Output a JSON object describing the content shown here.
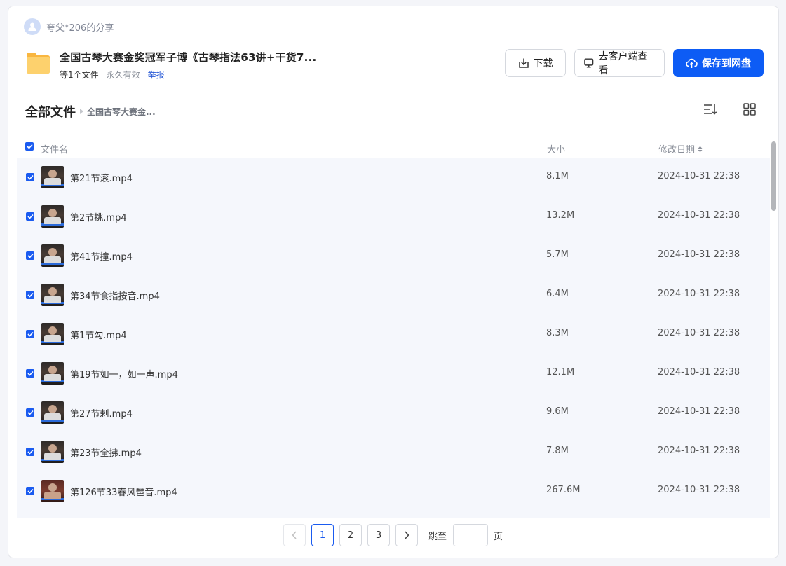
{
  "share": {
    "user_label": "夸父*206的分享",
    "file_title": "全国古琴大赛金奖冠军子博《古琴指法63讲+干货7...",
    "file_count": "等1个文件",
    "validity": "永久有效",
    "report_label": "举报"
  },
  "actions": {
    "download_label": "下载",
    "client_label": "去客户端查看",
    "save_label": "保存到网盘"
  },
  "breadcrumb": {
    "root": "全部文件",
    "current": "全国古琴大赛金..."
  },
  "table": {
    "col_name": "文件名",
    "col_size": "大小",
    "col_date": "修改日期",
    "rows": [
      {
        "name": "第21节滚.mp4",
        "size": "8.1M",
        "date": "2024-10-31 22:38"
      },
      {
        "name": "第2节挑.mp4",
        "size": "13.2M",
        "date": "2024-10-31 22:38"
      },
      {
        "name": "第41节撞.mp4",
        "size": "5.7M",
        "date": "2024-10-31 22:38"
      },
      {
        "name": "第34节食指按音.mp4",
        "size": "6.4M",
        "date": "2024-10-31 22:38"
      },
      {
        "name": "第1节勾.mp4",
        "size": "8.3M",
        "date": "2024-10-31 22:38"
      },
      {
        "name": "第19节如一，如一声.mp4",
        "size": "12.1M",
        "date": "2024-10-31 22:38"
      },
      {
        "name": "第27节剌.mp4",
        "size": "9.6M",
        "date": "2024-10-31 22:38"
      },
      {
        "name": "第23节全拂.mp4",
        "size": "7.8M",
        "date": "2024-10-31 22:38"
      },
      {
        "name": "第126节33春风琶音.mp4",
        "size": "267.6M",
        "date": "2024-10-31 22:38"
      }
    ]
  },
  "pagination": {
    "pages": [
      "1",
      "2",
      "3"
    ],
    "current_page": "1",
    "jump_label": "跳至",
    "jump_suffix": "页"
  },
  "icons": {
    "avatar": "user-icon",
    "folder": "folder-icon",
    "download": "download-icon",
    "client": "monitor-icon",
    "save": "cloud-upload-icon",
    "sort": "sort-icon",
    "grid": "grid-view-icon"
  },
  "colors": {
    "accent": "#0d5cf5",
    "checkbox": "#1a5bf0",
    "folder": "#fdc55a",
    "row_bg": "#f5f7fc"
  }
}
